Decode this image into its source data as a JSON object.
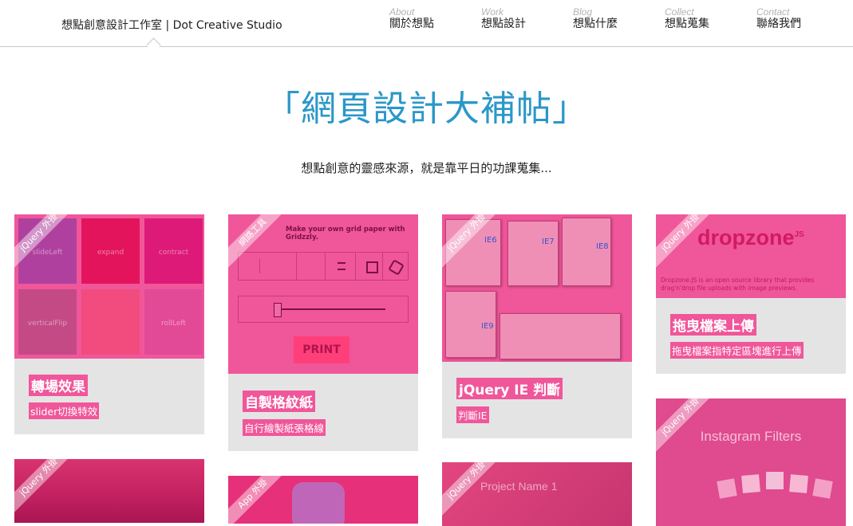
{
  "header": {
    "brand": "想點創意設計工作室 | Dot Creative Studio",
    "nav": [
      {
        "en": "About",
        "zh": "關於想點"
      },
      {
        "en": "Work",
        "zh": "想點設計"
      },
      {
        "en": "Blog",
        "zh": "想點什麼"
      },
      {
        "en": "Collect",
        "zh": "想點蒐集"
      },
      {
        "en": "Contact",
        "zh": "聯絡我們"
      }
    ]
  },
  "hero": {
    "title": "「網頁設計大補帖」",
    "subtitle": "想點創意的靈感來源，就是靠平日的功課蒐集..."
  },
  "cards": [
    {
      "ribbon": "jQuery 外掛",
      "title": "轉場效果",
      "desc": "slider切換特效",
      "tiles": [
        "slideLeft",
        "expand",
        "contract",
        "verticalFlip",
        "",
        "rollLeft"
      ]
    },
    {
      "ribbon": "網路工具",
      "title": "自製格紋紙",
      "desc": "自行繪製紙張格線",
      "headline": "Make your own grid paper with Gridzzly.",
      "button": "PRINT"
    },
    {
      "ribbon": "jQuery 外掛",
      "title": "jQuery IE 判斷",
      "desc": "判斷IE",
      "windows": [
        "IE6",
        "IE7",
        "IE8",
        "IE9"
      ]
    },
    {
      "ribbon": "jQuery 外掛",
      "title": "拖曳檔案上傳",
      "desc": "拖曳檔案指特定區塊進行上傳",
      "logo": "dropzone",
      "logo_suffix": "JS",
      "blurb": "Dropzone.JS is an open source library that provides drag'n'drop file uploads with image previews."
    },
    {
      "ribbon": "jQuery 外掛",
      "title": "",
      "desc": ""
    },
    {
      "ribbon": "jQuery 外掛",
      "title": "",
      "desc": "",
      "overlay_text": "Instagram Filters"
    },
    {
      "ribbon": "jQuery 外掛",
      "title": "",
      "desc": ""
    },
    {
      "ribbon": "App 外掛",
      "title": "",
      "desc": ""
    },
    {
      "ribbon": "jQuery 外掛",
      "title": "",
      "desc": "",
      "overlay_text": "Project Name 1"
    }
  ],
  "colors": {
    "accent": "#2a97c8",
    "overlay": "#f0569a",
    "card_bg": "#e4e4e4"
  }
}
